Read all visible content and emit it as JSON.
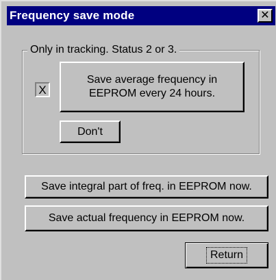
{
  "window": {
    "title": "Frequency save mode",
    "close_glyph": "✕"
  },
  "group": {
    "label": "Only in tracking. Status 2 or 3."
  },
  "checkbox": {
    "mark": "X",
    "checked": true
  },
  "buttons": {
    "save_average_line1": "Save average frequency in",
    "save_average_line2": "EEPROM every 24 hours.",
    "dont": "Don't",
    "save_integral": "Save integral part of freq. in EEPROM now.",
    "save_actual": "Save actual frequency in EEPROM now.",
    "return": "Return"
  },
  "colors": {
    "titlebar": "#000080",
    "face": "#c0c0c0",
    "shadow": "#808080",
    "highlight": "#ffffff"
  }
}
